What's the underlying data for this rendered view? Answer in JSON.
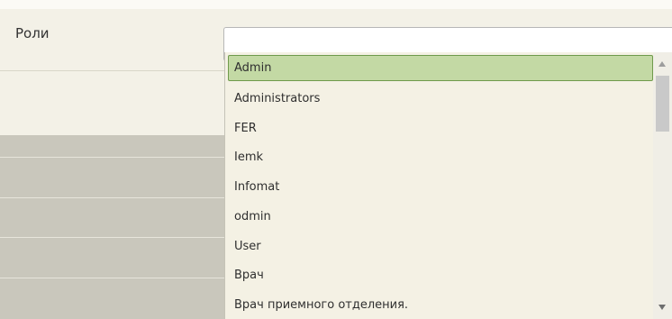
{
  "form": {
    "roles_label": "Роли",
    "roles_input_value": ""
  },
  "dropdown": {
    "selected_index": 0,
    "options": [
      "Admin",
      "Administrators",
      "FER",
      "Iemk",
      "Infomat",
      "odmin",
      "User",
      "Врач",
      "Врач приемного отделения."
    ]
  },
  "colors": {
    "selected_background": "#c3d9a4",
    "selected_border": "#6f9a4c",
    "dropdown_background": "#f4f1e4"
  }
}
